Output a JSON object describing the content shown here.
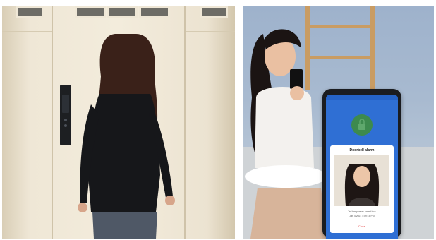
{
  "left_scene": {
    "subject": "woman-facing-door",
    "device": "smart-door-lock"
  },
  "right_scene": {
    "subject": "woman-with-phone",
    "app": {
      "title": "",
      "dialog": {
        "title": "Doorbell alarm",
        "message_line_1": "Tell the person: smart lock",
        "message_line_2": "Jan 4 2021 4:09:15 PM",
        "button_label": "Close"
      }
    }
  },
  "colors": {
    "app_blue": "#2f6fd4",
    "lock_green": "#3d8a4e",
    "close_red": "#e33b3b",
    "door_cream": "#efe7d6"
  }
}
